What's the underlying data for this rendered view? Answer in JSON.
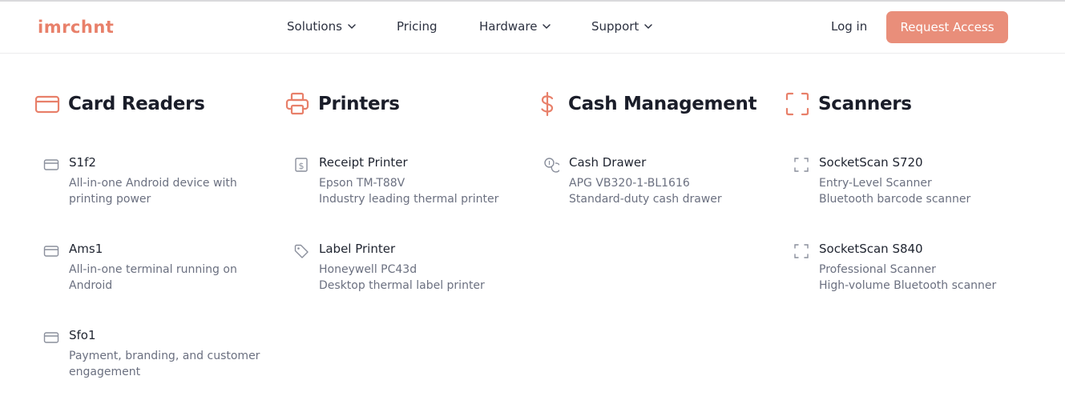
{
  "header": {
    "logo": "imrchnt",
    "nav": [
      {
        "label": "Solutions",
        "dropdown": true
      },
      {
        "label": "Pricing",
        "dropdown": false
      },
      {
        "label": "Hardware",
        "dropdown": true
      },
      {
        "label": "Support",
        "dropdown": true
      }
    ],
    "login": "Log in",
    "cta": "Request Access"
  },
  "colors": {
    "accent": "#e8806a",
    "cta_bg": "#e98e7a",
    "heading": "#1a1d29",
    "muted": "#6b7080",
    "item_icon": "#8a8f9c"
  },
  "columns": [
    {
      "title": "Card Readers",
      "icon": "credit-card-icon",
      "items": [
        {
          "name": "S1f2",
          "desc": "All-in-one Android device with printing power",
          "icon": "credit-card-icon"
        },
        {
          "name": "Ams1",
          "desc": "All-in-one terminal running on Android",
          "icon": "credit-card-icon"
        },
        {
          "name": "Sfo1",
          "desc": "Payment, branding, and customer engagement",
          "icon": "credit-card-icon"
        }
      ]
    },
    {
      "title": "Printers",
      "icon": "printer-icon",
      "items": [
        {
          "name": "Receipt Printer",
          "desc_line1": "Epson TM-T88V",
          "desc_line2": "Industry leading thermal printer",
          "icon": "receipt-icon"
        },
        {
          "name": "Label Printer",
          "desc_line1": "Honeywell PC43d",
          "desc_line2": "Desktop thermal label printer",
          "icon": "tag-icon"
        }
      ]
    },
    {
      "title": "Cash Management",
      "icon": "dollar-icon",
      "items": [
        {
          "name": "Cash Drawer",
          "desc_line1": "APG VB320-1-BL1616",
          "desc_line2": "Standard-duty cash drawer",
          "icon": "coins-icon"
        }
      ]
    },
    {
      "title": "Scanners",
      "icon": "scan-icon",
      "items": [
        {
          "name": "SocketScan S720",
          "desc_line1": "Entry-Level Scanner",
          "desc_line2": "Bluetooth barcode scanner",
          "icon": "scan-icon"
        },
        {
          "name": "SocketScan S840",
          "desc_line1": "Professional Scanner",
          "desc_line2": "High-volume Bluetooth scanner",
          "icon": "scan-icon"
        }
      ]
    }
  ]
}
